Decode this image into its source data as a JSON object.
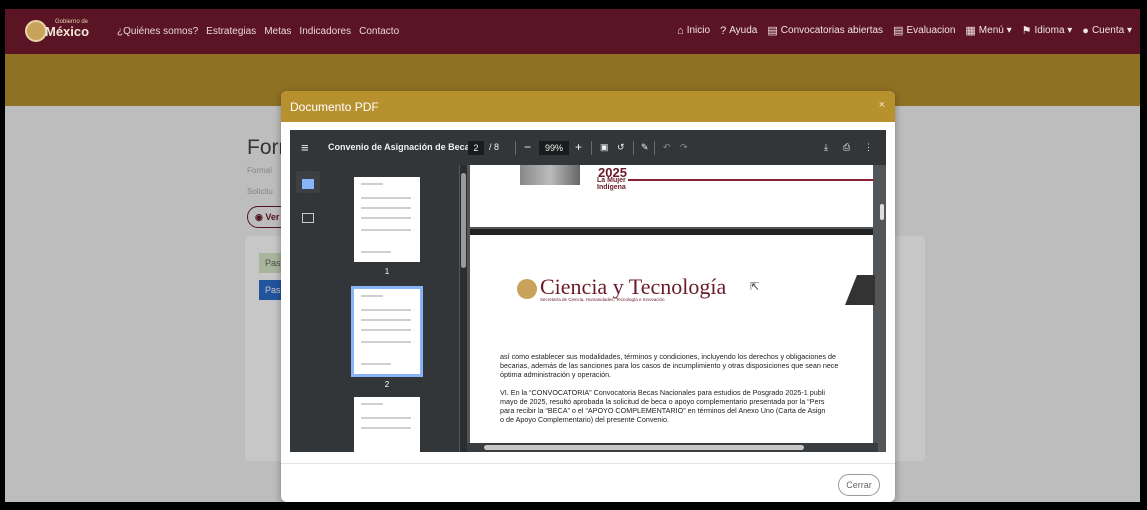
{
  "nav": {
    "logo_text": "México",
    "logo_small": "Gobierno de",
    "links": [
      "¿Quiénes somos?",
      "Estrategias",
      "Metas",
      "Indicadores",
      "Contacto"
    ],
    "right": [
      {
        "icon": "home-icon",
        "label": "Inicio"
      },
      {
        "icon": "help-icon",
        "label": "Ayuda"
      },
      {
        "icon": "document-icon",
        "label": "Convocatorias abiertas"
      },
      {
        "icon": "document-icon",
        "label": "Evaluacion"
      },
      {
        "icon": "menu-icon",
        "label": "Menú ▾"
      },
      {
        "icon": "flag-icon",
        "label": "Idioma ▾"
      },
      {
        "icon": "user-icon",
        "label": "Cuenta ▾"
      }
    ]
  },
  "underlying": {
    "title": "Form",
    "subtitle": "Formal",
    "solicitud": "Solicitu",
    "ver_label": "Ver",
    "step1": "Pas",
    "step2": "Pas"
  },
  "modal": {
    "title": "Documento PDF",
    "close": "×",
    "cerrar": "Cerrar"
  },
  "pdf": {
    "doc_title": "Convenio de Asignación de Beca",
    "page_current": "2",
    "page_total": "/ 8",
    "zoom": "99%",
    "thumbs": [
      {
        "label": "1",
        "selected": false
      },
      {
        "label": "2",
        "selected": true
      },
      {
        "label": "",
        "selected": false
      }
    ],
    "header_year": "2025",
    "header_mujer": "La Mujer\nIndígena",
    "brand": "Ciencia y Tecnología",
    "brand_sub": "Secretaría de Ciencia, Humanidades, Tecnología e Innovación",
    "lines": [
      "así como establecer sus modalidades, términos y condiciones, incluyendo los derechos y obligaciones de",
      "becarias, además de las sanciones para los casos de incumplimiento y otras disposiciones que sean nece",
      "óptima administración y operación."
    ],
    "lines2": [
      "VI. En la “CONVOCATORIA” Convocatoria Becas Nacionales para estudios de Posgrado 2025-1 publi",
      "mayo de 2025, resultó aprobada la solicitud de beca o apoyo complementario presentada por la “Pers",
      "para recibir la “BECA” o el “APOYO COMPLEMENTARIO” en términos del Anexo Uno (Carta de Asign",
      "o de Apoyo Complementario) del presente Convenio."
    ]
  }
}
